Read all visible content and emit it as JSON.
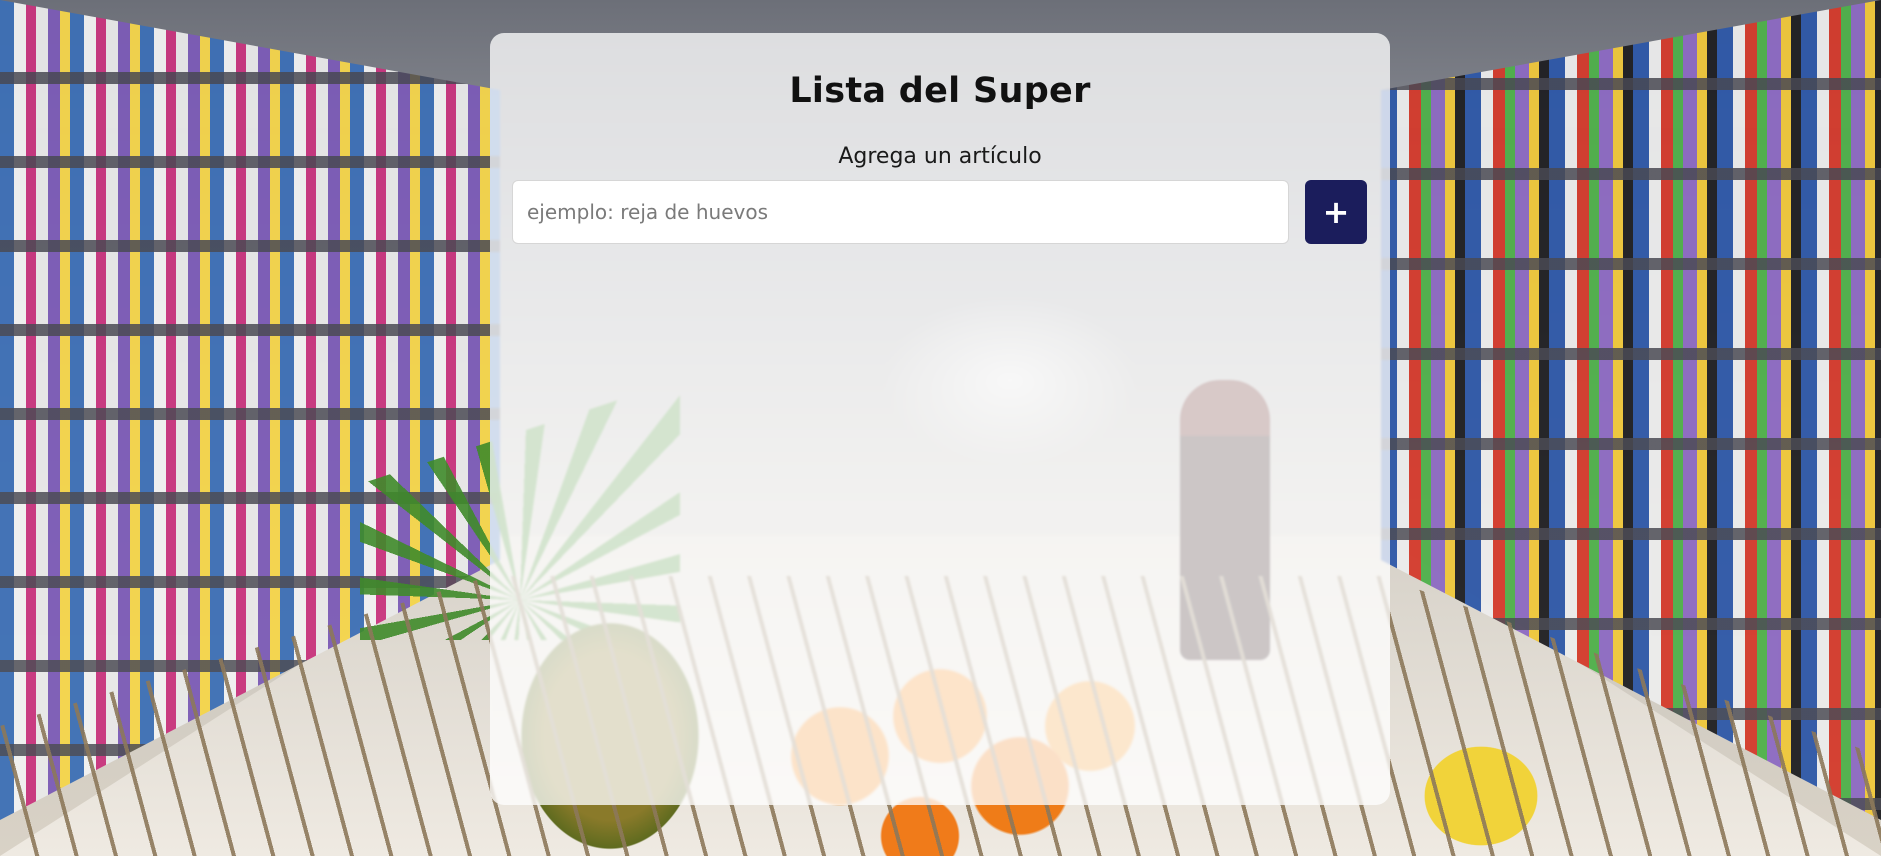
{
  "app": {
    "title": "Lista del Super"
  },
  "form": {
    "heading": "Agrega un artículo",
    "input_placeholder": "ejemplo: reja de huevos",
    "input_value": "",
    "add_button_label": "+",
    "add_button_icon": "plus-icon"
  },
  "colors": {
    "card_background": "rgba(255,255,255,0.76)",
    "add_button_background": "#1b1d5c",
    "add_button_text": "#ffffff",
    "title_text": "#111111"
  },
  "background": {
    "subject": "supermarket-aisle-with-shopping-cart"
  }
}
